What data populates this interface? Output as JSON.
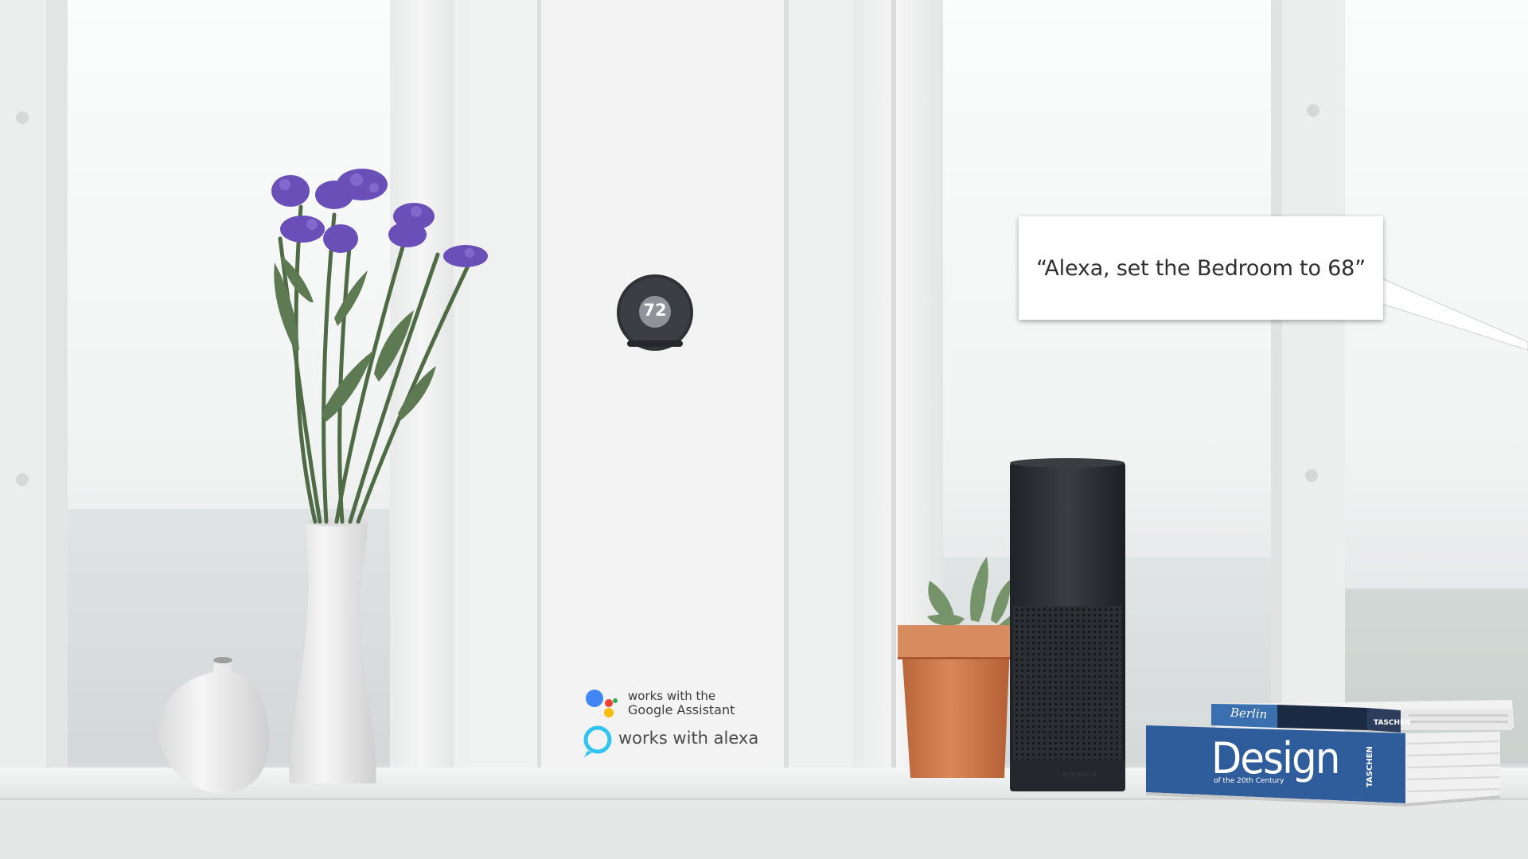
{
  "callout": {
    "text": "“Alexa, set the Bedroom to 68”"
  },
  "thermostat": {
    "reading": "72"
  },
  "badges": {
    "google": {
      "line1": "works with the",
      "line2": "Google Assistant",
      "dot_colors": [
        "#4285f4",
        "#ea4335",
        "#fbbc05",
        "#34a853"
      ]
    },
    "alexa": {
      "text": "works with alexa",
      "ring_color": "#31c4f3"
    }
  },
  "echo": {
    "brand": "amazon"
  },
  "books": {
    "design": {
      "title": "Design",
      "subtitle": "of the 20th Century",
      "publisher": "TASCHEN"
    },
    "berlin": {
      "title": "Berlin",
      "publisher": "TASCHEN"
    }
  },
  "colors": {
    "wall": "#f3f4f4",
    "shelf": "#eceeee",
    "flowers": "#6a4fb8",
    "stems": "#4f6b45",
    "pot": "#cf7a4b",
    "echo": "#2a2d31",
    "book": "#2f5d9c"
  }
}
